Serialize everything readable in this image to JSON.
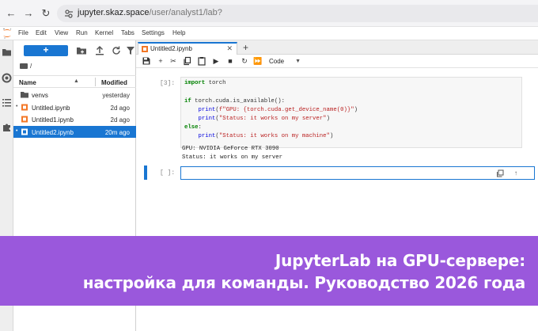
{
  "browser": {
    "url_host": "jupyter.skaz.space",
    "url_path": "/user/analyst1/lab?",
    "back_icon": "arrow-left-icon",
    "forward_icon": "arrow-right-icon",
    "reload_icon": "reload-icon"
  },
  "menubar": {
    "items": [
      "File",
      "Edit",
      "View",
      "Run",
      "Kernel",
      "Tabs",
      "Settings",
      "Help"
    ]
  },
  "filebrowser": {
    "new_label": "+",
    "breadcrumb": "/",
    "columns": {
      "name": "Name",
      "modified": "Modified"
    },
    "files": [
      {
        "name": "venvs",
        "modified": "yesterday",
        "type": "folder",
        "running": false,
        "selected": false
      },
      {
        "name": "Untitled.ipynb",
        "modified": "2d ago",
        "type": "notebook",
        "running": true,
        "selected": false
      },
      {
        "name": "Untitled1.ipynb",
        "modified": "2d ago",
        "type": "notebook",
        "running": false,
        "selected": false
      },
      {
        "name": "Untitled2.ipynb",
        "modified": "20m ago",
        "type": "notebook",
        "running": true,
        "selected": true
      }
    ]
  },
  "notebook": {
    "tab_label": "Untitled2.ipynb",
    "cell_type": "Code",
    "cell1_prompt": "[3]:",
    "cell1_code": [
      "import torch",
      "",
      "if torch.cuda.is_available():",
      "    print(f\"GPU: {torch.cuda.get_device_name(0)}\")",
      "    print(\"Status: it works on my server\")",
      "else:",
      "    print(\"Status: it works on my machine\")"
    ],
    "cell1_output": [
      "GPU: NVIDIA GeForce RTX 3090",
      "Status: it works on my server"
    ],
    "cell2_prompt": "[ ]:"
  },
  "banner": {
    "line1": "JupyterLab на GPU-сервере:",
    "line2": "настройка для команды. Руководство 2026 года"
  },
  "colors": {
    "accent": "#1976d2",
    "banner": "#9a58dc",
    "notebook_icon": "#f37726"
  }
}
